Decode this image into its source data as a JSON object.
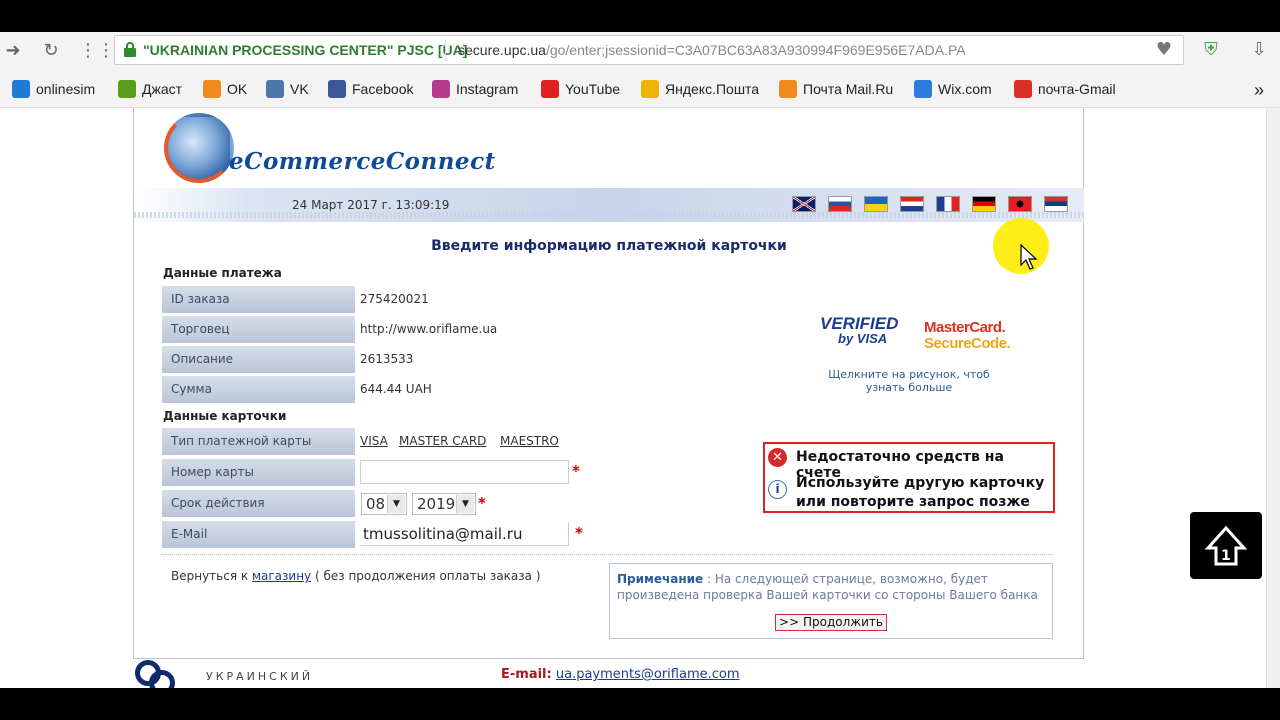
{
  "browser": {
    "site_identity": "\"UKRAINIAN PROCESSING CENTER\" PJSC [UA]",
    "url_domain": "secure.upc.ua",
    "url_path": "/go/enter;jsessionid=C3A07BC63A83A930994F969E956E7ADA.PA",
    "nav_icons": [
      "forward-icon",
      "reload-icon",
      "apps-icon"
    ],
    "bookmarks": [
      {
        "label": "onlinesim",
        "icon": "onlinesim-icon",
        "color": "#1e7bd6"
      },
      {
        "label": "Джаст",
        "icon": "jc-icon",
        "color": "#5a9e1c"
      },
      {
        "label": "OK",
        "icon": "odnoklassniki-icon",
        "color": "#f08a1c"
      },
      {
        "label": "VK",
        "icon": "vk-icon",
        "color": "#4a76a8"
      },
      {
        "label": "Facebook",
        "icon": "facebook-icon",
        "color": "#3b5998"
      },
      {
        "label": "Instagram",
        "icon": "instagram-icon",
        "color": "#b83a8c"
      },
      {
        "label": "YouTube",
        "icon": "youtube-icon",
        "color": "#e02020"
      },
      {
        "label": "Яндекс.Пошта",
        "icon": "yandex-mail-icon",
        "color": "#f0b400"
      },
      {
        "label": "Почта Mail.Ru",
        "icon": "mailru-icon",
        "color": "#f08a1c"
      },
      {
        "label": "Wix.com",
        "icon": "wix-icon",
        "color": "#2b7bdc"
      },
      {
        "label": "почта-Gmail",
        "icon": "gmail-icon",
        "color": "#d93025"
      }
    ],
    "more_label": "»"
  },
  "page": {
    "logo_text": "eCommerceConnect",
    "datetime": "24 Март 2017 г. 13:09:19",
    "flags": [
      "uk-flag-icon",
      "ru-flag-icon",
      "ua-flag-icon",
      "hr-flag-icon",
      "fr-flag-icon",
      "de-flag-icon",
      "al-flag-icon",
      "rs-flag-icon"
    ],
    "title": "Введите информацию платежной карточки",
    "payment_section": "Данные платежа",
    "payment_rows": [
      {
        "label": "ID заказа",
        "value": "275420021"
      },
      {
        "label": "Торговец",
        "value": "http://www.oriflame.ua"
      },
      {
        "label": "Описание",
        "value": "2613533"
      },
      {
        "label": "Сумма",
        "value": "644.44 UAH"
      }
    ],
    "card_section": "Данные карточки",
    "card_type_label": "Тип платежной карты",
    "card_types": [
      "VISA",
      "MASTER CARD",
      "MAESTRO"
    ],
    "card_number_label": "Номер карты",
    "card_number_value": "",
    "expiry_label": "Срок действия",
    "expiry_month": "08",
    "expiry_year": "2019",
    "email_label": "E-Mail",
    "email_value": "tmussolitina@mail.ru",
    "required_mark": "*",
    "verified_line1": "VERIFIED",
    "verified_line2": "by VISA",
    "mc_line1": "MasterCard.",
    "mc_line2": "SecureCode.",
    "secure_hint": "Щелкните на рисунок, чтоб узнать больше",
    "error_title": "Недостаточно средств на счете",
    "error_hint": "Используйте другую карточку или повторите запрос позже",
    "back_prefix": "Вернуться к",
    "back_link": "магазину",
    "back_suffix": "( без продолжения оплаты заказа )",
    "note_label": "Примечание",
    "note_text": ": На следующей странице, возможно, будет произведена проверка Вашей карточки со стороны Вашего банка",
    "continue_button": ">> Продолжить",
    "footer_company": "УКРАИНСКИЙ",
    "footer_email_label": "E-mail:",
    "footer_email": "ua.payments@oriflame.com"
  }
}
